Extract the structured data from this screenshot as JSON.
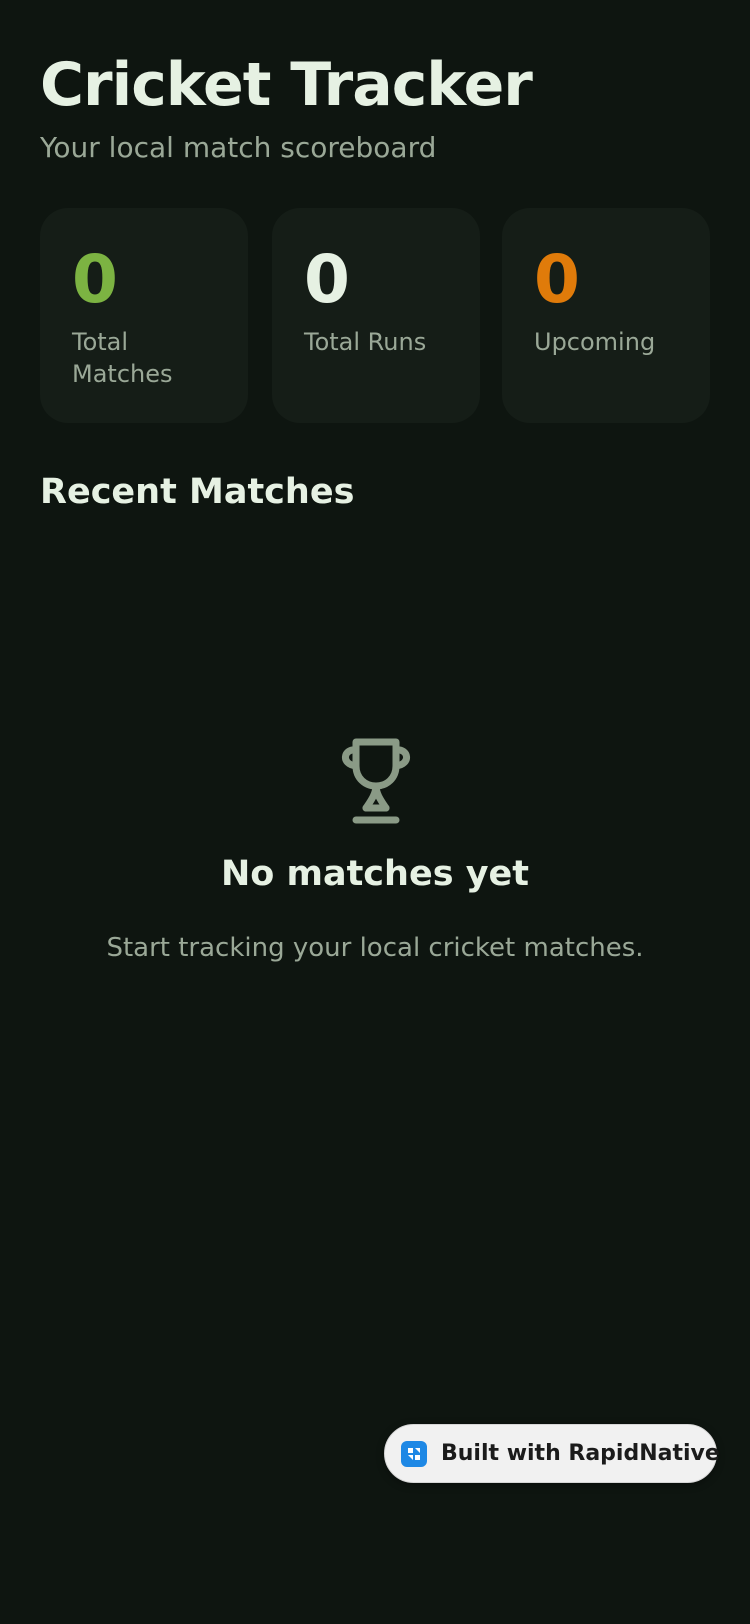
{
  "header": {
    "title": "Cricket Tracker",
    "subtitle": "Your local match scoreboard"
  },
  "stats": [
    {
      "value": "0",
      "label": "Total Matches",
      "color": "#7cb342"
    },
    {
      "value": "0",
      "label": "Total Runs",
      "color": "#e6f1e3"
    },
    {
      "value": "0",
      "label": "Upcoming",
      "color": "#e07b0a"
    }
  ],
  "recent": {
    "title": "Recent Matches"
  },
  "empty_state": {
    "icon": "trophy-icon",
    "title": "No matches yet",
    "text": "Start tracking your local cricket matches."
  },
  "badge": {
    "icon": "rapidnative-logo-icon",
    "text": "Built with RapidNative",
    "accent": "#1e88e5"
  }
}
